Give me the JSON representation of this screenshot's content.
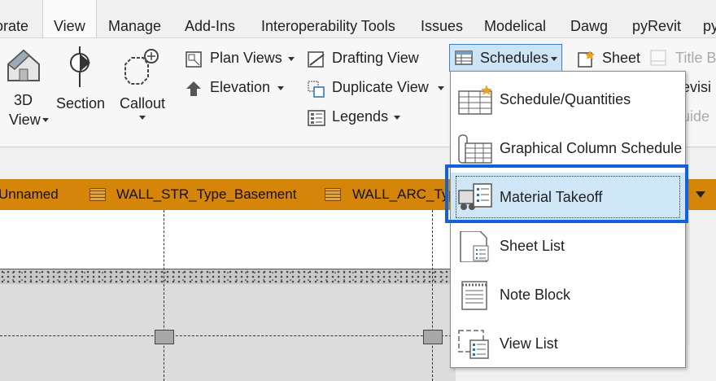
{
  "tabs": [
    "orate",
    "View",
    "Manage",
    "Add-Ins",
    "Interoperability Tools",
    "Issues",
    "Modelical",
    "Dawg",
    "pyRevit",
    "py"
  ],
  "ribbon": {
    "three_d_line1": "3D",
    "three_d_line2": "View",
    "section": "Section",
    "callout": "Callout",
    "plan_views": "Plan  Views",
    "elevation": "Elevation",
    "drafting_view": "Drafting  View",
    "duplicate_view": "Duplicate  View",
    "legends": "Legends",
    "schedules": "Schedules",
    "sheet": "Sheet",
    "title_block": "Title  B",
    "revision_partial": "evisi",
    "guide_partial": "uide"
  },
  "doc_tabs": [
    "Unnamed",
    "WALL_STR_Type_Basement",
    "WALL_ARC_Typ"
  ],
  "dropdown": {
    "items": [
      "Schedule/Quantities",
      "Graphical Column Schedule",
      "Material Takeoff",
      "Sheet List",
      "Note Block",
      "View List"
    ],
    "highlighted": "Material Takeoff"
  },
  "colors": {
    "doc_tab_bar": "#d4850a",
    "highlight_border": "#1062d8",
    "hover_fill": "#cfe6f7"
  }
}
